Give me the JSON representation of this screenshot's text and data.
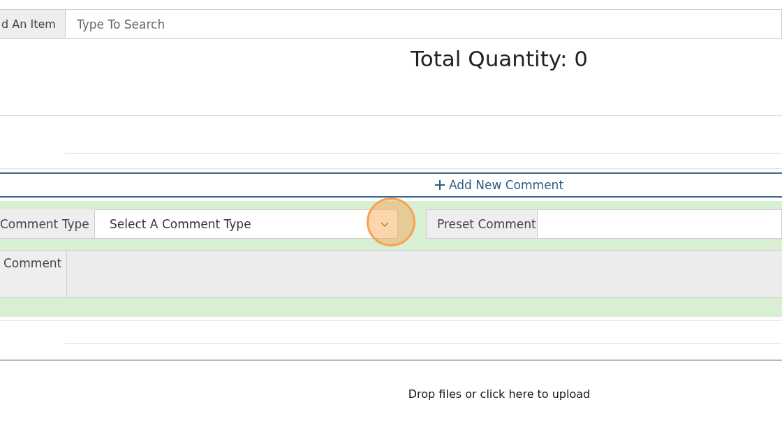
{
  "item_search": {
    "label": "d An Item",
    "placeholder": "Type To Search"
  },
  "total": {
    "text": "Total Quantity: 0"
  },
  "add_comment": {
    "label": "Add New Comment"
  },
  "comment_form": {
    "comment_type": {
      "label": "Comment Type",
      "placeholder": "Select A Comment Type"
    },
    "preset_comment": {
      "label": "Preset Comment"
    },
    "comment": {
      "label": "Comment"
    }
  },
  "upload": {
    "text": "Drop files or click here to upload"
  }
}
